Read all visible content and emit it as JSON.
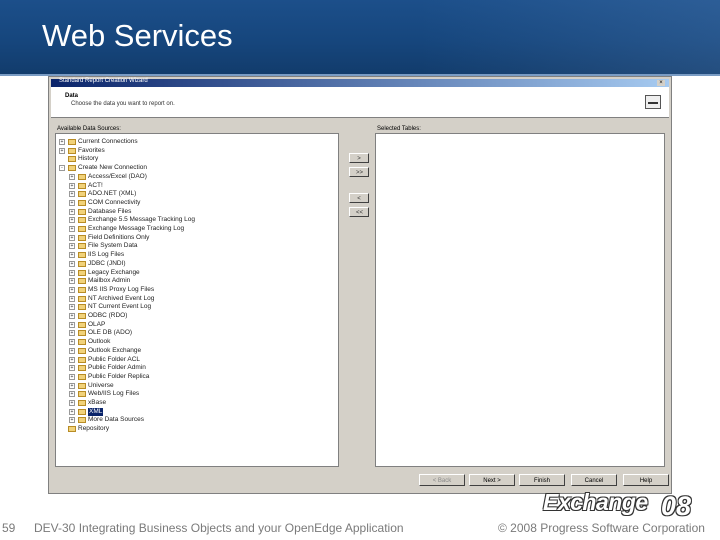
{
  "slide": {
    "title": "Web Services",
    "page_number": "59",
    "footer_left": "DEV-30 Integrating Business Objects and your OpenEdge Application",
    "footer_right": "© 2008 Progress Software Corporation",
    "header_color": "#16467d",
    "logo": {
      "word": "Exchange",
      "year": "08"
    }
  },
  "wizard": {
    "window_title": "Standard Report Creation Wizard",
    "header_title": "Data",
    "header_subtitle": "Choose the data you want to report on.",
    "available_label": "Available Data Sources:",
    "selected_label": "Selected Tables:",
    "move_buttons": [
      ">",
      ">>",
      "<",
      "<<"
    ],
    "tree_items": [
      {
        "label": "Current Connections",
        "expander": "+",
        "level": 0,
        "selected": false
      },
      {
        "label": "Favorites",
        "expander": "+",
        "level": 0,
        "selected": false
      },
      {
        "label": "History",
        "expander": "",
        "level": 0,
        "selected": false
      },
      {
        "label": "Create New Connection",
        "expander": "-",
        "level": 0,
        "selected": false
      },
      {
        "label": "Access/Excel (DAO)",
        "expander": "+",
        "level": 1,
        "selected": false
      },
      {
        "label": "ACT!",
        "expander": "+",
        "level": 1,
        "selected": false
      },
      {
        "label": "ADO.NET (XML)",
        "expander": "+",
        "level": 1,
        "selected": false
      },
      {
        "label": "COM Connectivity",
        "expander": "+",
        "level": 1,
        "selected": false
      },
      {
        "label": "Database Files",
        "expander": "+",
        "level": 1,
        "selected": false
      },
      {
        "label": "Exchange 5.5 Message Tracking Log",
        "expander": "+",
        "level": 1,
        "selected": false
      },
      {
        "label": "Exchange Message Tracking Log",
        "expander": "+",
        "level": 1,
        "selected": false
      },
      {
        "label": "Field Definitions Only",
        "expander": "+",
        "level": 1,
        "selected": false
      },
      {
        "label": "File System Data",
        "expander": "+",
        "level": 1,
        "selected": false
      },
      {
        "label": "IIS Log Files",
        "expander": "+",
        "level": 1,
        "selected": false
      },
      {
        "label": "JDBC (JNDI)",
        "expander": "+",
        "level": 1,
        "selected": false
      },
      {
        "label": "Legacy Exchange",
        "expander": "+",
        "level": 1,
        "selected": false
      },
      {
        "label": "Mailbox Admin",
        "expander": "+",
        "level": 1,
        "selected": false
      },
      {
        "label": "MS IIS Proxy Log Files",
        "expander": "+",
        "level": 1,
        "selected": false
      },
      {
        "label": "NT Archived Event Log",
        "expander": "+",
        "level": 1,
        "selected": false
      },
      {
        "label": "NT Current Event Log",
        "expander": "+",
        "level": 1,
        "selected": false
      },
      {
        "label": "ODBC (RDO)",
        "expander": "+",
        "level": 1,
        "selected": false
      },
      {
        "label": "OLAP",
        "expander": "+",
        "level": 1,
        "selected": false
      },
      {
        "label": "OLE DB (ADO)",
        "expander": "+",
        "level": 1,
        "selected": false
      },
      {
        "label": "Outlook",
        "expander": "+",
        "level": 1,
        "selected": false
      },
      {
        "label": "Outlook Exchange",
        "expander": "+",
        "level": 1,
        "selected": false
      },
      {
        "label": "Public Folder ACL",
        "expander": "+",
        "level": 1,
        "selected": false
      },
      {
        "label": "Public Folder Admin",
        "expander": "+",
        "level": 1,
        "selected": false
      },
      {
        "label": "Public Folder Replica",
        "expander": "+",
        "level": 1,
        "selected": false
      },
      {
        "label": "Universe",
        "expander": "+",
        "level": 1,
        "selected": false
      },
      {
        "label": "Web/IIS Log Files",
        "expander": "+",
        "level": 1,
        "selected": false
      },
      {
        "label": "xBase",
        "expander": "+",
        "level": 1,
        "selected": false
      },
      {
        "label": "XML",
        "expander": "+",
        "level": 1,
        "selected": true
      },
      {
        "label": "More Data Sources",
        "expander": "+",
        "level": 1,
        "selected": false
      },
      {
        "label": "Repository",
        "expander": "",
        "level": 0,
        "selected": false
      }
    ],
    "buttons": {
      "back": "< Back",
      "next": "Next >",
      "finish": "Finish",
      "cancel": "Cancel",
      "help": "Help"
    }
  }
}
